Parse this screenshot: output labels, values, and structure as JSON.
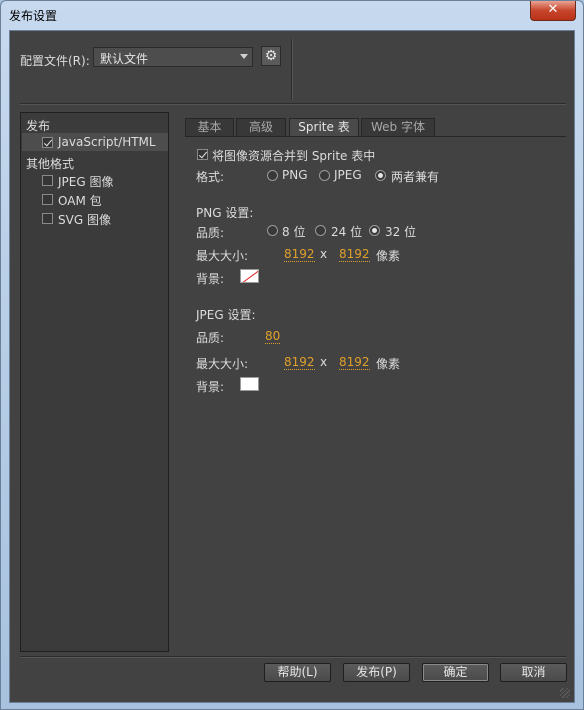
{
  "window": {
    "title": "发布设置",
    "close_glyph": "✕"
  },
  "profile": {
    "label": "配置文件(R):",
    "value": "默认文件",
    "gear_icon": "gear-icon",
    "gear_glyph": "⚙"
  },
  "left_panel": {
    "publish_header": "发布",
    "publish_item": {
      "label": "JavaScript/HTML",
      "checked": true
    },
    "other_header": "其他格式",
    "other_items": [
      {
        "label": "JPEG 图像",
        "checked": false
      },
      {
        "label": "OAM 包",
        "checked": false
      },
      {
        "label": "SVG 图像",
        "checked": false
      }
    ]
  },
  "tabs": [
    {
      "label": "基本",
      "active": false
    },
    {
      "label": "高级",
      "active": false
    },
    {
      "label": "Sprite 表",
      "active": true
    },
    {
      "label": "Web 字体",
      "active": false
    }
  ],
  "sprite": {
    "merge_label": "将图像资源合并到 Sprite 表中",
    "merge_checked": true,
    "format_label": "格式:",
    "format_options": [
      "PNG",
      "JPEG",
      "两者兼有"
    ],
    "format_selected": "两者兼有",
    "png": {
      "header": "PNG 设置:",
      "quality_label": "品质:",
      "quality_options": [
        "8 位",
        "24 位",
        "32 位"
      ],
      "quality_selected": "32 位",
      "maxsize_label": "最大大小:",
      "width": "8192",
      "x": "x",
      "height": "8192",
      "unit": "像素",
      "bg_label": "背景:",
      "bg_color": "none"
    },
    "jpeg": {
      "header": "JPEG 设置:",
      "quality_label": "品质:",
      "quality": "80",
      "maxsize_label": "最大大小:",
      "width": "8192",
      "x": "x",
      "height": "8192",
      "unit": "像素",
      "bg_label": "背景:",
      "bg_color": "#ffffff"
    }
  },
  "buttons": {
    "help": "帮助(L)",
    "publish": "发布(P)",
    "ok": "确定",
    "cancel": "取消"
  }
}
